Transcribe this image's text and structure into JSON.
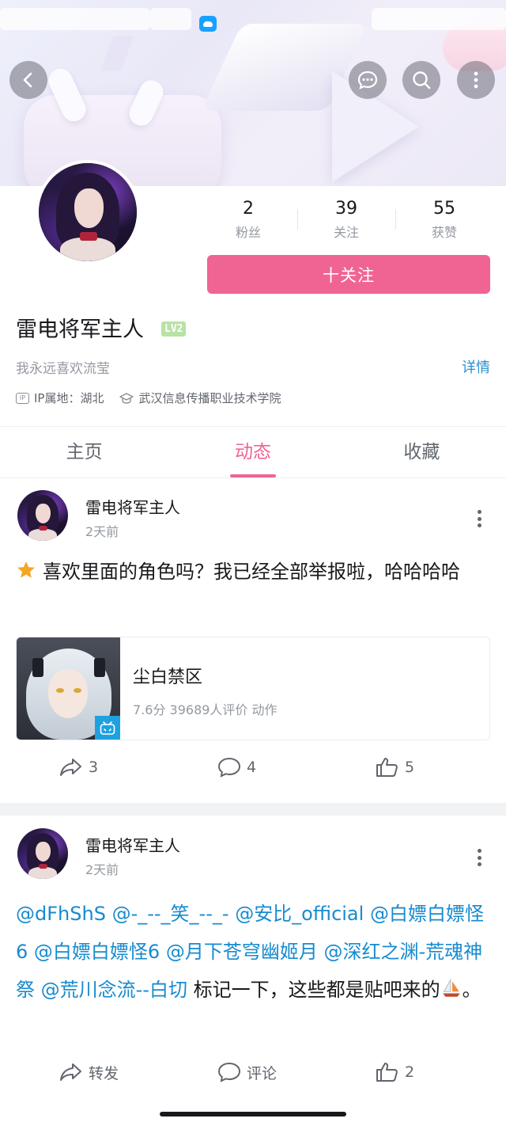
{
  "profile": {
    "name": "雷电将军主人",
    "level": "LV2",
    "bio": "我永远喜欢流莹",
    "detail_label": "详情",
    "ip_label": "IP属地：湖北",
    "school": "武汉信息传播职业技术学院",
    "follow_label": "十关注",
    "stats": [
      {
        "num": "2",
        "label": "粉丝"
      },
      {
        "num": "39",
        "label": "关注"
      },
      {
        "num": "55",
        "label": "获赞"
      }
    ]
  },
  "tabs": [
    {
      "label": "主页"
    },
    {
      "label": "动态"
    },
    {
      "label": "收藏"
    }
  ],
  "active_tab": "动态",
  "posts": [
    {
      "author": "雷电将军主人",
      "time": "2天前",
      "text": "喜欢里面的角色吗？我已经全部举报啦，哈哈哈哈",
      "card": {
        "title": "尘白禁区",
        "meta": "7.6分  39689人评价  动作"
      },
      "actions": {
        "forward": "3",
        "comment": "4",
        "like": "5"
      }
    },
    {
      "author": "雷电将军主人",
      "time": "2天前",
      "mentions": [
        "@dFhShS",
        "@-_--_笑_--_-",
        "@安比_official",
        "@白嫖白嫖怪6",
        "@白嫖白嫖怪6",
        "@月下苍穹幽姬月",
        "@深红之渊-荒魂神祭",
        "@荒川念流--白切"
      ],
      "text_tail": "标记一下，这些都是贴吧来的",
      "text_end": "。",
      "actions": {
        "forward": "转发",
        "comment": "评论",
        "like": "2"
      }
    }
  ],
  "colors": {
    "accent_pink": "#f06493",
    "mention_blue": "#178bcf",
    "level_green": "#b7e3a4"
  },
  "icons": [
    "back-arrow-icon",
    "message-icon",
    "search-icon",
    "more-icon",
    "forward-icon",
    "comment-icon",
    "like-icon",
    "star-icon",
    "sailboat-icon",
    "graduation-cap-icon",
    "ip-icon",
    "bilibili-tv-icon"
  ]
}
